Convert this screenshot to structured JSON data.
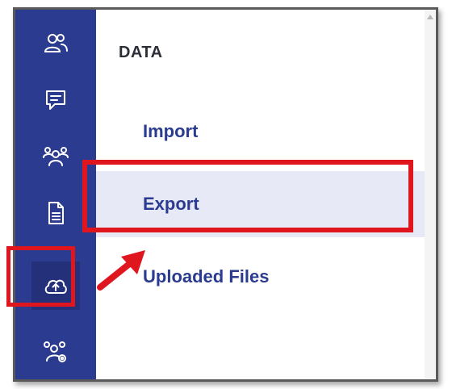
{
  "sidebar": {
    "items": [
      {
        "icon": "users-icon",
        "label": ""
      },
      {
        "icon": "message-icon",
        "label": ""
      },
      {
        "icon": "team-icon",
        "label": ""
      },
      {
        "icon": "document-icon",
        "label": ""
      },
      {
        "icon": "cloud-upload-icon",
        "label": ""
      },
      {
        "icon": "team-settings-icon",
        "label": ""
      }
    ],
    "active_index": 4
  },
  "panel": {
    "section_title": "DATA",
    "items": [
      {
        "label": "Import"
      },
      {
        "label": "Export"
      },
      {
        "label": "Uploaded Files"
      }
    ],
    "selected_index": 1
  },
  "colors": {
    "sidebar": "#2b3b8f",
    "accent_text": "#2b3b8f",
    "selected_bg": "#e7e9f7",
    "annotation": "#e0161f"
  }
}
